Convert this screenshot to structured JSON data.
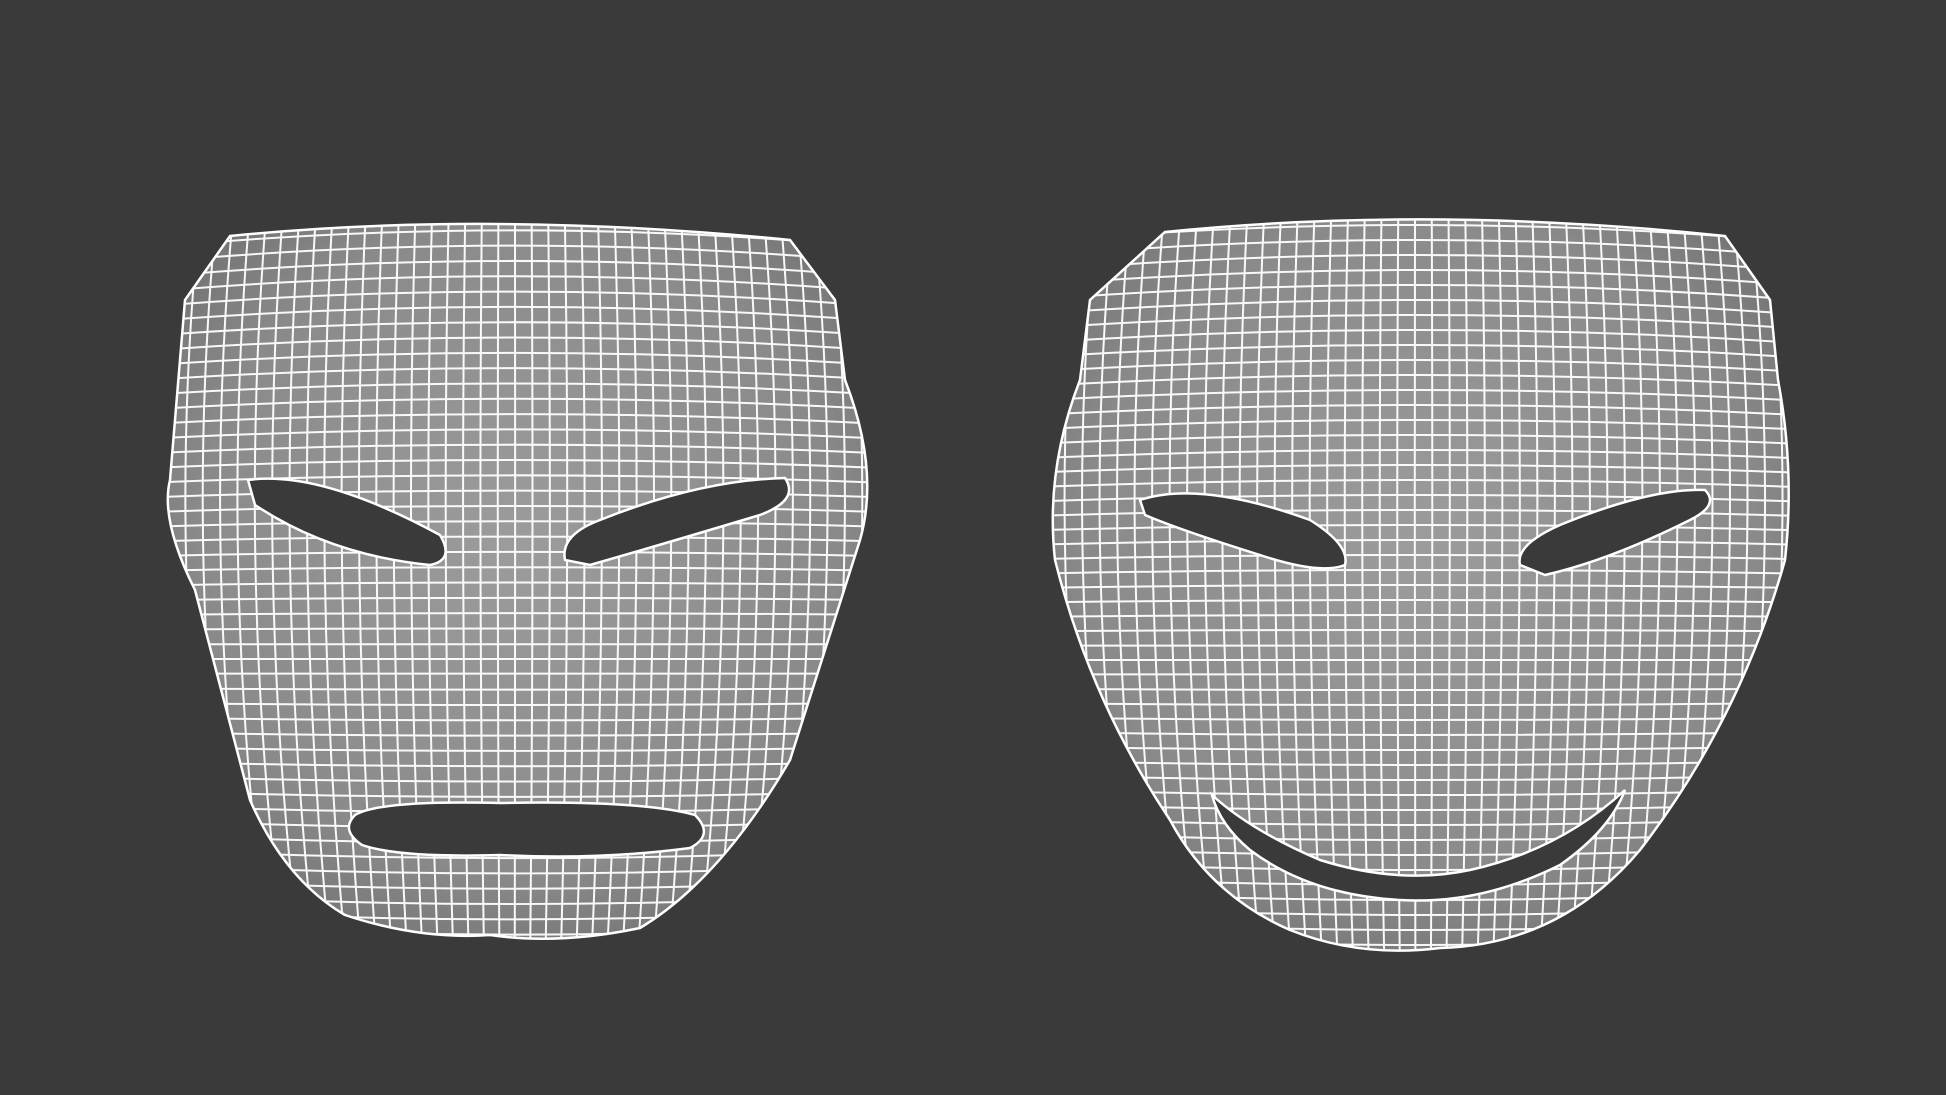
{
  "scene": {
    "background_color": "#3a3a3a",
    "surface_color": "#8c8c8c",
    "wire_color": "#ffffff",
    "masks": [
      {
        "name": "tragedy-mask",
        "expression": "neutral"
      },
      {
        "name": "comedy-mask",
        "expression": "smiling"
      }
    ]
  }
}
